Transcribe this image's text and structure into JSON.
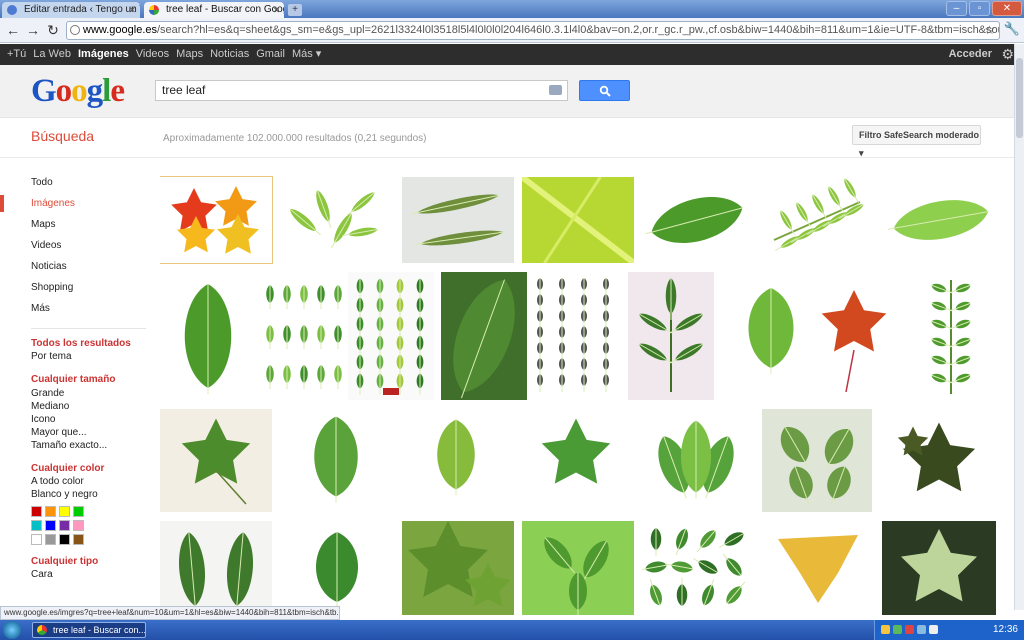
{
  "browser": {
    "tabs": [
      {
        "title": "Editar entrada ‹ Tengo un TIC"
      },
      {
        "title": "tree leaf - Buscar con Google"
      }
    ],
    "url_host": "www.google.es",
    "url_path": "/search?hl=es&q=sheet&gs_sm=e&gs_upl=2621l3324l0l3518l5l4l0l0l0l204l646l0.3.1l4l0&bav=on.2,or.r_gc.r_pw.,cf.osb&biw=1440&bih=811&um=1&ie=UTF-8&tbm=isch&source=og&sa=N"
  },
  "gbar": {
    "links": [
      "+Tú",
      "La Web",
      "Imágenes",
      "Videos",
      "Maps",
      "Noticias",
      "Gmail",
      "Más ▾"
    ],
    "active": "Imágenes",
    "signin": "Acceder"
  },
  "search": {
    "query": "tree leaf",
    "section": "Búsqueda",
    "stats": "Aproximadamente 102.000.000 resultados (0,21 segundos)",
    "safesearch": "Filtro SafeSearch moderado"
  },
  "sidebar": {
    "nav": [
      "Todo",
      "Imágenes",
      "Maps",
      "Videos",
      "Noticias",
      "Shopping",
      "Más"
    ],
    "active": "Imágenes",
    "sections": [
      {
        "head": "Todos los resultados",
        "options": [
          "Por tema"
        ]
      },
      {
        "head": "Cualquier tamaño",
        "options": [
          "Grande",
          "Mediano",
          "Icono",
          "Mayor que...",
          "Tamaño exacto..."
        ]
      },
      {
        "head": "Cualquier color",
        "options": [
          "A todo color",
          "Blanco y negro"
        ]
      },
      {
        "head": "Cualquier tipo",
        "options": [
          "Cara"
        ]
      }
    ],
    "swatch_colors": [
      "#cc0000",
      "#fb940b",
      "#ffff00",
      "#00cc00",
      "#03c0c6",
      "#0000ff",
      "#762ca7",
      "#ff98bf",
      "#ffffff",
      "#999999",
      "#000000",
      "#885418"
    ]
  },
  "status_url": "www.google.es/imgres?q=tree+leaf&num=10&um=1&hl=es&biw=1440&bih=811&tbm=isch&tb...",
  "clock": "12:36",
  "taskbar_item": "tree leaf - Buscar con..."
}
